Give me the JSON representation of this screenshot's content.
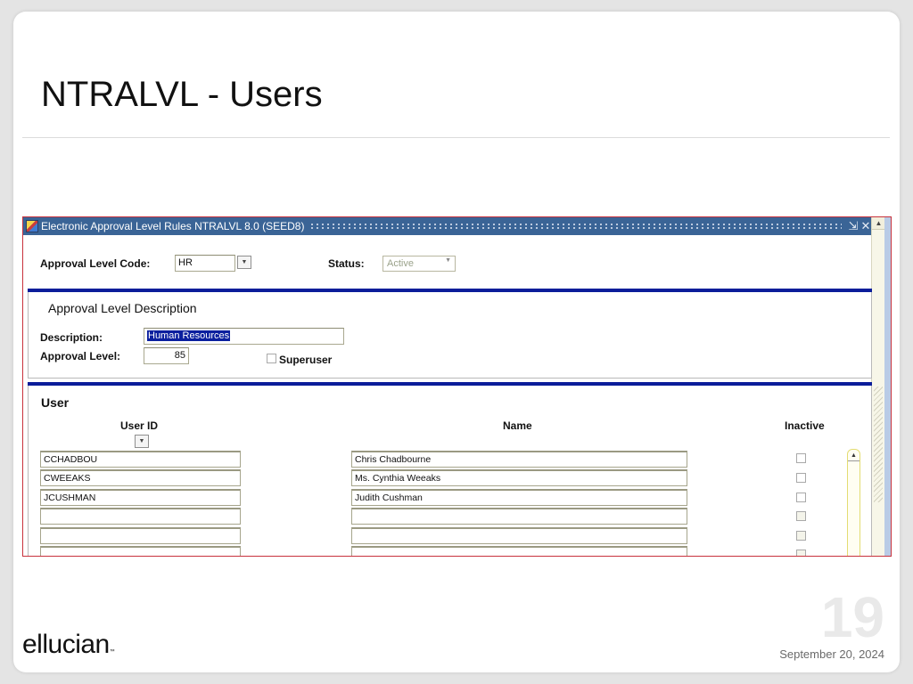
{
  "slide": {
    "title": "NTRALVL - Users",
    "page_number": "19",
    "date": "September 20, 2024",
    "logo": "ellucian",
    "logo_tm": "™"
  },
  "app": {
    "window_title": "Electronic Approval Level Rules  NTRALVL  8.0  (SEED8)",
    "icons": {
      "app": "form-icon",
      "minimize": "minimize-icon",
      "close": "close-icon",
      "scroll_up": "scroll-up-arrow"
    },
    "key_block": {
      "code_label": "Approval Level Code:",
      "code_value": "HR",
      "status_label": "Status:",
      "status_value": "Active"
    },
    "description_block": {
      "heading": "Approval Level Description",
      "description_label": "Description:",
      "description_value": "Human Resources",
      "level_label": "Approval Level:",
      "level_value": "85",
      "superuser_label": "Superuser",
      "superuser_checked": false
    },
    "user_block": {
      "heading": "User",
      "columns": {
        "user_id": "User ID",
        "name": "Name",
        "inactive": "Inactive"
      },
      "rows": [
        {
          "user_id": "CCHADBOU",
          "name": "Chris Chadbourne",
          "inactive": false
        },
        {
          "user_id": "CWEEAKS",
          "name": "Ms. Cynthia Weeaks",
          "inactive": false
        },
        {
          "user_id": "JCUSHMAN",
          "name": "Judith Cushman",
          "inactive": false
        },
        {
          "user_id": "",
          "name": "",
          "inactive": false
        },
        {
          "user_id": "",
          "name": "",
          "inactive": false
        },
        {
          "user_id": "",
          "name": "",
          "inactive": false
        }
      ]
    }
  }
}
